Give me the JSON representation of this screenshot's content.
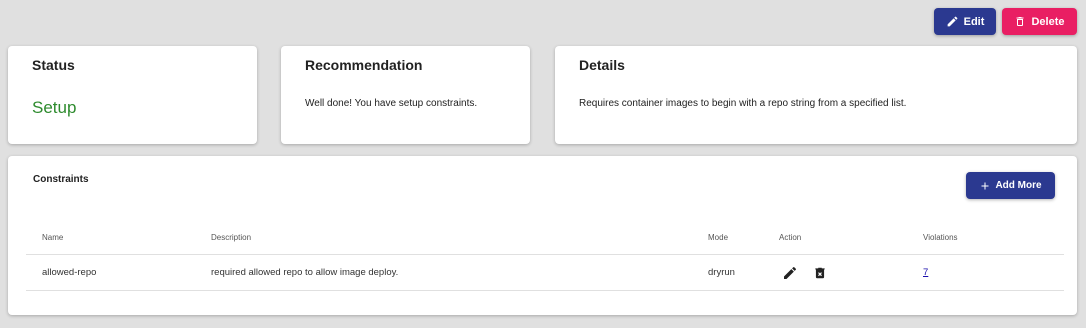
{
  "toolbar": {
    "edit_label": "Edit",
    "delete_label": "Delete"
  },
  "colors": {
    "primary": "#2b3990",
    "danger": "#e91e63",
    "status_green": "#2e8b2e"
  },
  "cards": {
    "status": {
      "title": "Status",
      "value": "Setup"
    },
    "recommendation": {
      "title": "Recommendation",
      "text": "Well done! You have setup constraints."
    },
    "details": {
      "title": "Details",
      "text": "Requires container images to begin with a repo string from a specified list."
    }
  },
  "constraints": {
    "title": "Constraints",
    "add_more_label": "Add More",
    "columns": [
      "Name",
      "Description",
      "Mode",
      "Action",
      "Violations"
    ],
    "rows": [
      {
        "name": "allowed-repo",
        "description": "required allowed repo to allow image deploy.",
        "mode": "dryrun",
        "actions": [
          "pencil-icon",
          "delete-x-icon"
        ],
        "violations": "7"
      }
    ]
  }
}
